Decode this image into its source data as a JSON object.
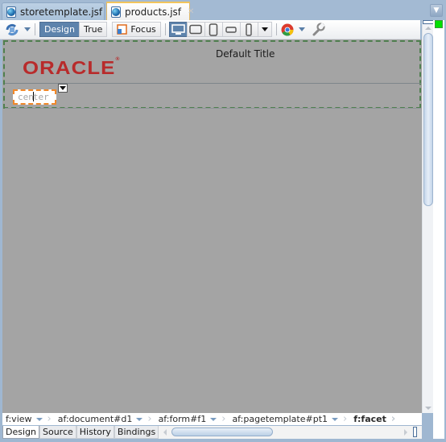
{
  "tabs": [
    {
      "label": "storetemplate.jsf",
      "active": false
    },
    {
      "label": "products.jsf",
      "active": true
    }
  ],
  "toolbar": {
    "refresh_icon": "refresh-icon",
    "design_label": "Design",
    "true_label": "True",
    "focus_label": "Focus",
    "devices": [
      "desktop-icon",
      "tablet-landscape-icon",
      "tablet-portrait-icon",
      "phone-landscape-icon",
      "phone-portrait-icon"
    ],
    "browser_icon": "chrome-icon",
    "settings_icon": "wrench-icon"
  },
  "canvas": {
    "default_title": "Default Title",
    "logo_text": "ORACLE",
    "facet_label": "center"
  },
  "breadcrumb": [
    {
      "label": "f:view",
      "current": false
    },
    {
      "label": "af:document#d1",
      "current": false
    },
    {
      "label": "af:form#f1",
      "current": false
    },
    {
      "label": "af:pagetemplate#pt1",
      "current": false
    },
    {
      "label": "f:facet",
      "current": true
    }
  ],
  "bottom_tabs": [
    {
      "label": "Design",
      "active": true
    },
    {
      "label": "Source",
      "active": false
    },
    {
      "label": "History",
      "active": false
    },
    {
      "label": "Bindings",
      "active": false
    }
  ],
  "colors": {
    "accent": "#5d83ac",
    "oracle_red": "#b82b2b",
    "selection_orange": "#f0882a",
    "template_border_green": "#4f7f4f",
    "status_green": "#00e000"
  }
}
